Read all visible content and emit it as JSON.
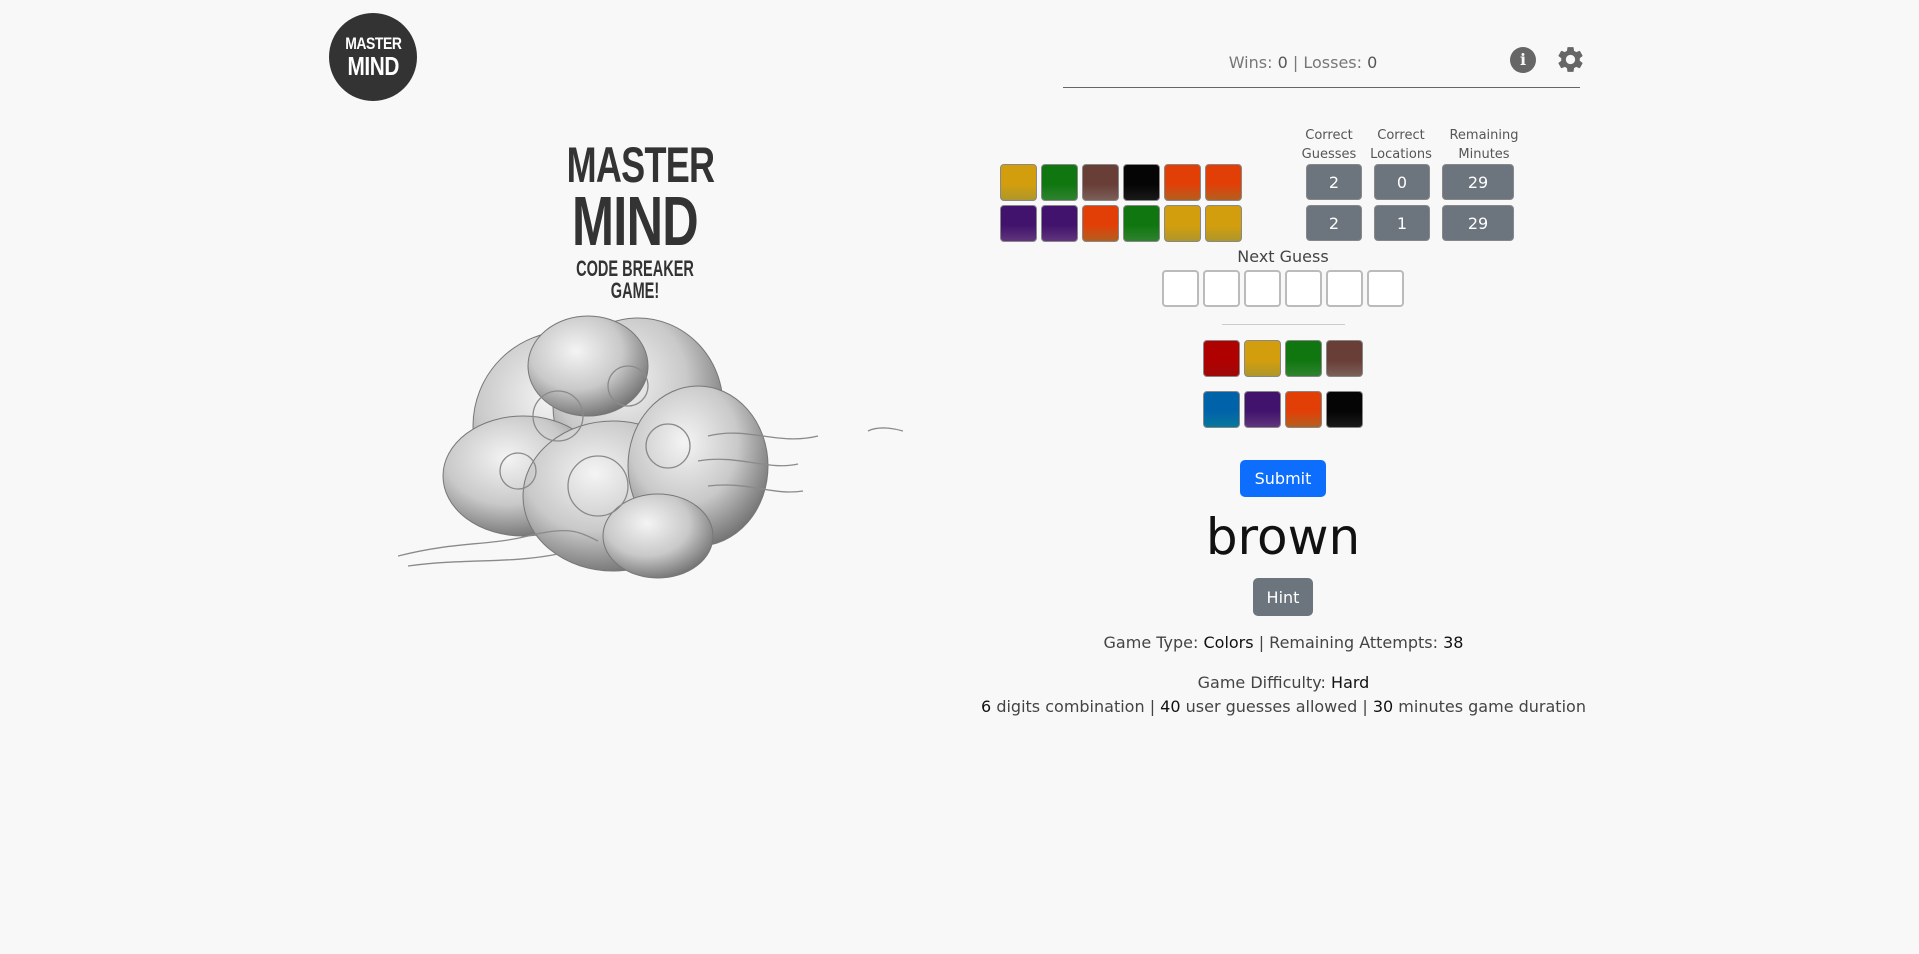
{
  "header": {
    "logo_line1": "MASTER",
    "logo_line2": "MIND",
    "wins_label": "Wins:",
    "wins": "0",
    "separator": "|",
    "losses_label": "Losses:",
    "losses": "0",
    "info_icon": "info-icon",
    "settings_icon": "gear-icon"
  },
  "hero": {
    "title_line1": "MASTER",
    "title_line2": "MIND",
    "subtitle": "CODE BREAKER GAME!",
    "image": "brain-illustration"
  },
  "colors": {
    "red": "#d40c0c",
    "yellow": "#e8c939",
    "green": "#3fae3f",
    "brown": "#a37e76",
    "cyan": "#0b9fd0",
    "purple": "#8246a6",
    "orange": "#f07f2a",
    "black": "#222222",
    "accent": "#0d6efd",
    "stat_bg": "#6c757d"
  },
  "board": {
    "columns": {
      "correct_guesses": "Correct Guesses",
      "correct_locations": "Correct Locations",
      "remaining_minutes": "Remaining Minutes"
    },
    "guesses": [
      {
        "pegs": [
          "yellow",
          "green",
          "brown",
          "black",
          "orange",
          "orange"
        ],
        "correct_guesses": "2",
        "correct_locations": "0",
        "remaining_minutes": "29"
      },
      {
        "pegs": [
          "purple",
          "purple",
          "orange",
          "green",
          "yellow",
          "yellow"
        ],
        "correct_guesses": "2",
        "correct_locations": "1",
        "remaining_minutes": "29"
      }
    ]
  },
  "next_guess": {
    "label": "Next Guess",
    "slots": [
      "",
      "",
      "",
      "",
      "",
      ""
    ]
  },
  "palette": [
    [
      "red",
      "yellow",
      "green",
      "brown"
    ],
    [
      "cyan",
      "purple",
      "orange",
      "black"
    ]
  ],
  "actions": {
    "submit_label": "Submit",
    "hint_label": "Hint"
  },
  "hovered_color": "brown",
  "game_info": {
    "type_label": "Game Type:",
    "type": "Colors",
    "attempts_label": "Remaining Attempts:",
    "attempts": "38",
    "difficulty_label": "Game Difficulty:",
    "difficulty": "Hard",
    "digits": "6",
    "digits_text": "digits combination",
    "guesses": "40",
    "guesses_text": "user guesses allowed",
    "minutes": "30",
    "minutes_text": "minutes game duration"
  }
}
